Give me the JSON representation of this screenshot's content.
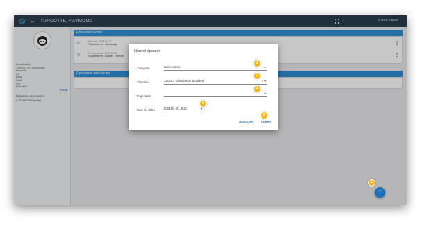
{
  "topbar": {
    "patient_name": "TURCOTTE, RAYMOND",
    "user_name": "Pilote Pilote"
  },
  "sidebar": {
    "identification_lines": [
      "Identification",
      "TURCOTTE, RAYMOND",
      "Masculin",
      "AN",
      "DDN",
      "NAM",
      "CIP",
      "Etat: Actif"
    ],
    "plus_label": "PLUS",
    "dossier_heading": "Numéros de dossier",
    "dossier_number": "# 12345678901(Iuniia)"
  },
  "episodes_actifs": {
    "title": "Épisodes actifs",
    "rows": [
      {
        "date": "9 février 2023 10:27",
        "desc": "Suivi externe - Oncologie"
      },
      {
        "date": "19 novembre 2022 10:32",
        "desc": "Suivi externe - Adulte - Service"
      }
    ]
  },
  "episodes_anterieurs": {
    "title": "Épisodes antérieurs"
  },
  "dialog": {
    "title": "Nouvel épisode",
    "fields": [
      {
        "label": "Catégorie",
        "value": "Suivi externe"
      },
      {
        "label": "Clientèle",
        "value": "CDJDC - Clinique de la douleur"
      },
      {
        "label": "Trajectoire",
        "value": ""
      },
      {
        "label": "Date de début",
        "value": "2023-03-28 10:21"
      }
    ],
    "cancel_label": "ANNULER",
    "create_label": "CRÉER"
  },
  "badges": [
    "1",
    "2",
    "3",
    "4",
    "5",
    "6"
  ],
  "fab_label": "+",
  "colors": {
    "topbar": "#2c3e50",
    "panel_header": "#2e8fd6",
    "accent": "#1e6fb7",
    "badge": "#f2b51e"
  }
}
